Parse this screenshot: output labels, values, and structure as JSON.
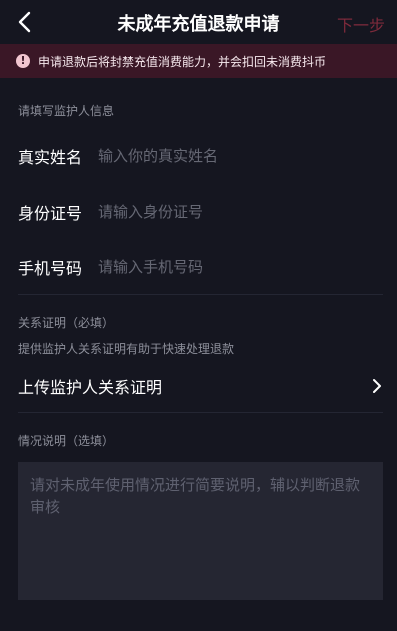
{
  "header": {
    "title": "未成年充值退款申请",
    "next_label": "下一步"
  },
  "warning": {
    "icon": "exclamation-icon",
    "text": "申请退款后将封禁充值消费能力，并会扣回未消费抖币"
  },
  "guardian_section": {
    "label": "请填写监护人信息",
    "fields": [
      {
        "label": "真实姓名",
        "placeholder": "输入你的真实姓名"
      },
      {
        "label": "身份证号",
        "placeholder": "请输入身份证号"
      },
      {
        "label": "手机号码",
        "placeholder": "请输入手机号码"
      }
    ]
  },
  "relation_section": {
    "label": "关系证明（必填）",
    "hint": "提供监护人关系证明有助于快速处理退款",
    "upload_label": "上传监护人关系证明"
  },
  "description_section": {
    "label": "情况说明（选填）",
    "placeholder": "请对未成年使用情况进行简要说明，辅以判断退款审核"
  },
  "colors": {
    "background": "#151620",
    "warning_bg": "#3a1726",
    "next_disabled": "#7d2a3b",
    "textarea_bg": "#252632"
  }
}
